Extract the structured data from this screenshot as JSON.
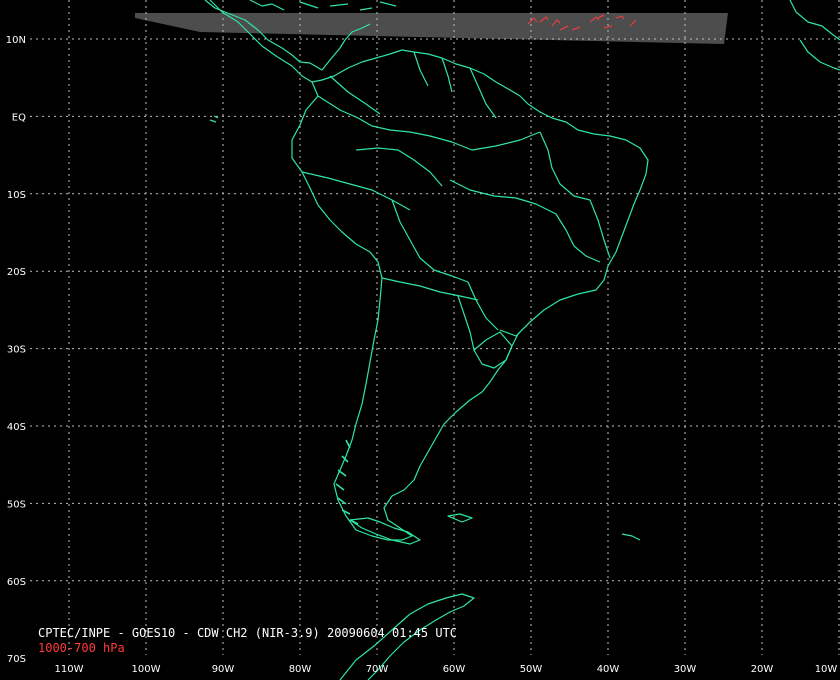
{
  "product": {
    "title": "CPTEC/INPE - GOES10 - CDW CH2 (NIR-3.9) 20090604 01:45 UTC",
    "level": "1000-700 hPa"
  },
  "axes": {
    "lat_labels": [
      "10N",
      "EQ",
      "10S",
      "20S",
      "30S",
      "40S",
      "50S",
      "60S",
      "70S"
    ],
    "lon_labels": [
      "110W",
      "100W",
      "90W",
      "80W",
      "70W",
      "60W",
      "50W",
      "40W",
      "30W",
      "20W",
      "10W"
    ]
  },
  "colors": {
    "background": "#000000",
    "coastline": "#2ee6a0",
    "grid": "#bfbfbf",
    "title_text": "#ffffff",
    "level_text": "#ff3b3b",
    "wind_vectors": "#ff3b3b",
    "satellite_swath": "#555555"
  }
}
